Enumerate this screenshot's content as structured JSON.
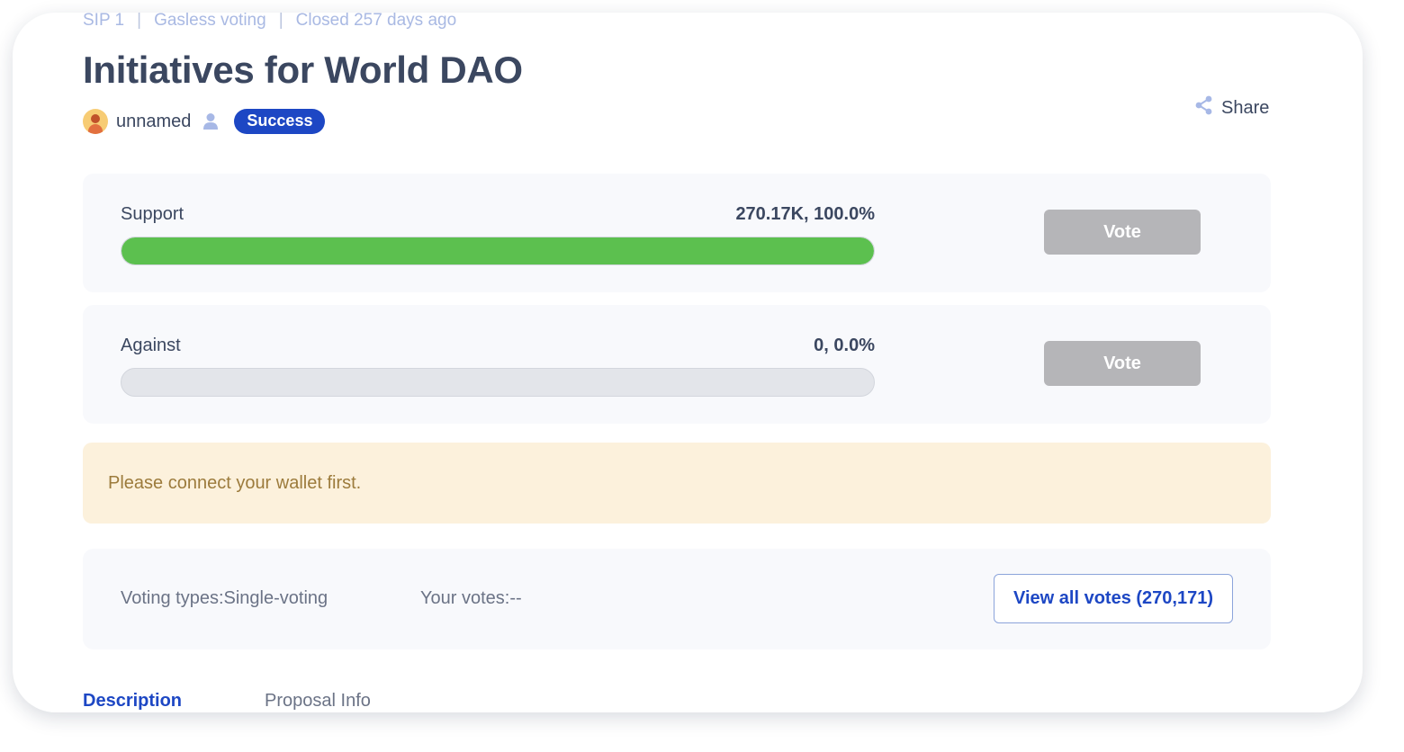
{
  "meta": {
    "sip": "SIP 1",
    "separator": "|",
    "voting_mode": "Gasless voting",
    "closed": "Closed 257 days ago"
  },
  "title": "Initiatives for World DAO",
  "author": {
    "name": "unnamed"
  },
  "status": {
    "label": "Success",
    "color": "#1d47c4"
  },
  "share_label": "Share",
  "options": [
    {
      "label": "Support",
      "amount": "270.17K, 100.0%",
      "percent": 100.0,
      "color": "#5cc04f",
      "vote_label": "Vote"
    },
    {
      "label": "Against",
      "amount": "0, 0.0%",
      "percent": 0.0,
      "color": "#5cc04f",
      "vote_label": "Vote"
    }
  ],
  "notice": "Please connect your wallet first.",
  "voting_info": {
    "voting_type": "Voting types:Single-voting",
    "your_votes": "Your votes:--",
    "view_all_label": "View all votes (270,171)"
  },
  "tabs": [
    {
      "label": "Description",
      "active": true
    },
    {
      "label": "Proposal Info",
      "active": false
    }
  ],
  "icons": {
    "user": "user-icon",
    "share": "share-icon",
    "avatar": "avatar"
  }
}
